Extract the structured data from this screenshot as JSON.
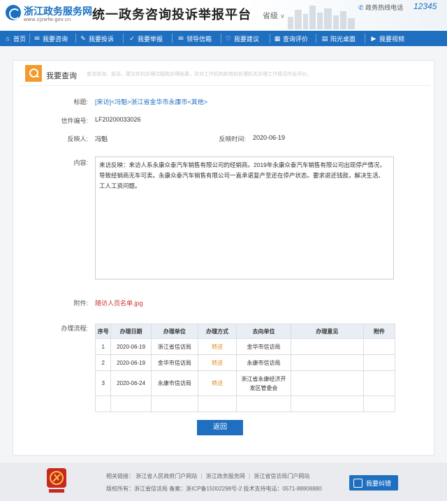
{
  "header": {
    "site_name": "浙江政务服务网",
    "site_url": "www.zjzwfw.gov.cn",
    "platform_title": "统一政务咨询投诉举报平台",
    "province_selector": "省级",
    "hotline_label": "政务热线电话",
    "hotline_number": "12345"
  },
  "nav": {
    "items": [
      {
        "label": "首页",
        "icon": "home-icon"
      },
      {
        "label": "我要咨询",
        "icon": "chat-icon"
      },
      {
        "label": "我要投诉",
        "icon": "pencil-icon"
      },
      {
        "label": "我要举报",
        "icon": "check-icon"
      },
      {
        "label": "领导信箱",
        "icon": "mail-icon"
      },
      {
        "label": "我要建议",
        "icon": "heart-icon"
      },
      {
        "label": "查询评价",
        "icon": "grid-icon"
      },
      {
        "label": "阳光桌面",
        "icon": "desktop-icon"
      },
      {
        "label": "我要视频",
        "icon": "video-icon"
      }
    ]
  },
  "query": {
    "title": "我要查询",
    "description": "查询咨询、投诉、建议件的办理过程和办理结果，并对工作机构和有权处理机关办理工作情况作出评价。"
  },
  "letter": {
    "subject_label": "标题:",
    "subject": "[来访]<冯魁>浙江省金华市永康市<其他>",
    "number_label": "信件编号:",
    "number": "LF20200033026",
    "reporter_label": "反映人:",
    "reporter": "冯魁",
    "time_label": "反映时间:",
    "time": "2020-06-19",
    "content_label": "内容:",
    "content": "来访反映：来访人系永康众泰汽车销售有限公司的经销商。2019年永康众泰汽车销售有限公司出现停产情况，导致经销商无车可卖。永康众泰汽车销售有限公司一直承诺复产至还在停产状态。要求退还钱款，解决生活、工人工资问题。",
    "attachment_label": "附件:",
    "attachment": "随访人员名单.jpg",
    "process_label": "办理流程:"
  },
  "process_table": {
    "headers": [
      "序号",
      "办理日期",
      "办理单位",
      "办理方式",
      "去向单位",
      "办理意见",
      "附件"
    ],
    "rows": [
      {
        "no": "1",
        "date": "2020-06-19",
        "unit": "浙江省信访局",
        "mode": "转送",
        "target": "金华市信访局",
        "opinion": "",
        "attach": ""
      },
      {
        "no": "2",
        "date": "2020-06-19",
        "unit": "金华市信访局",
        "mode": "转送",
        "target": "永康市信访局",
        "opinion": "",
        "attach": ""
      },
      {
        "no": "3",
        "date": "2020-06-24",
        "unit": "永康市信访局",
        "mode": "转送",
        "target": "浙江省永康经济开发区管委会",
        "opinion": "",
        "attach": ""
      }
    ]
  },
  "back_button": "返回",
  "footer": {
    "links_label": "相关链接：",
    "link1": "浙江省人民政府门户网站",
    "link2": "浙江政务服务网",
    "link3": "浙江省信访局门户网站",
    "copyright": "版权所有：浙江省信访局  备案：浙ICP备15002298号-2  技术支持电话：0571-88808880",
    "correct_button": "我要纠错"
  },
  "colors": {
    "primary": "#1f6fc1",
    "accent_orange": "#f29b2c",
    "link_red": "#d0322b"
  }
}
